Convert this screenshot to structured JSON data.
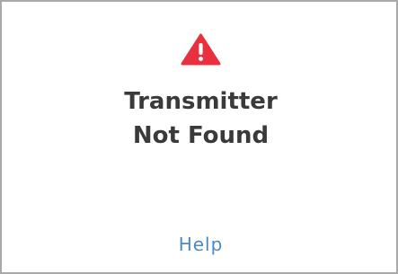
{
  "alert": {
    "icon": "warning-triangle-icon",
    "icon_color": "#e8303f",
    "title_line_1": "Transmitter",
    "title_line_2": "Not Found",
    "help_label": "Help",
    "link_color": "#4a8ac0"
  }
}
